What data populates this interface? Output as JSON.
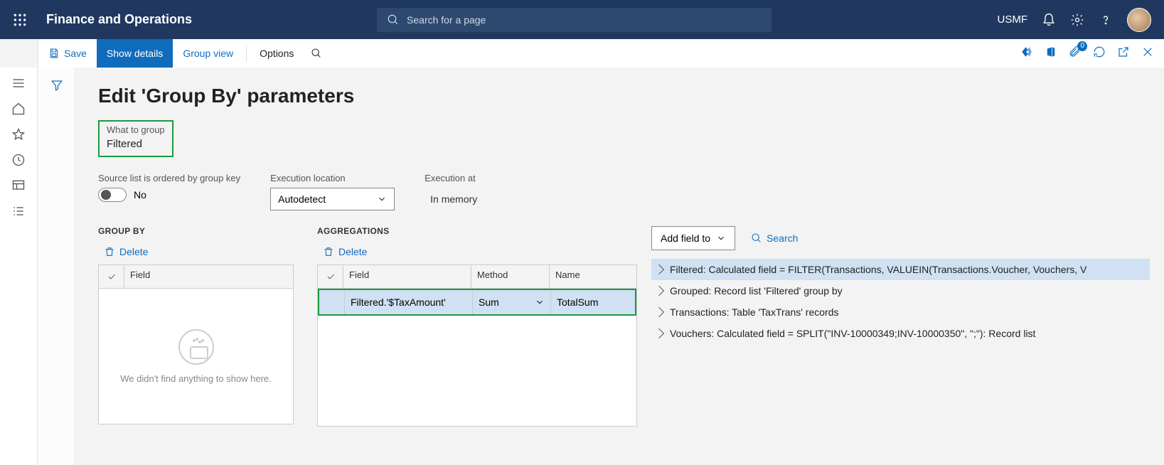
{
  "header": {
    "app_title": "Finance and Operations",
    "search_placeholder": "Search for a page",
    "entity": "USMF",
    "notif_count": "0"
  },
  "actionbar": {
    "save": "Save",
    "show_details": "Show details",
    "group_view": "Group view",
    "options": "Options"
  },
  "page": {
    "title": "Edit 'Group By' parameters",
    "what_to_group_label": "What to group",
    "what_to_group_value": "Filtered",
    "ordered_label": "Source list is ordered by group key",
    "ordered_value": "No",
    "exec_loc_label": "Execution location",
    "exec_loc_value": "Autodetect",
    "exec_at_label": "Execution at",
    "exec_at_value": "In memory"
  },
  "groupby": {
    "heading": "GROUP BY",
    "delete": "Delete",
    "field_header": "Field",
    "empty_msg": "We didn't find anything to show here."
  },
  "agg": {
    "heading": "AGGREGATIONS",
    "delete": "Delete",
    "field_header": "Field",
    "method_header": "Method",
    "name_header": "Name",
    "row": {
      "field": "Filtered.'$TaxAmount'",
      "method": "Sum",
      "name": "TotalSum"
    }
  },
  "side": {
    "add_field": "Add field to",
    "search": "Search",
    "tree": {
      "n0": "Filtered: Calculated field = FILTER(Transactions, VALUEIN(Transactions.Voucher, Vouchers, V",
      "n1": "Grouped: Record list 'Filtered' group by",
      "n2": "Transactions: Table 'TaxTrans' records",
      "n3": "Vouchers: Calculated field = SPLIT(\"INV-10000349;INV-10000350\", \";\"): Record list"
    }
  }
}
